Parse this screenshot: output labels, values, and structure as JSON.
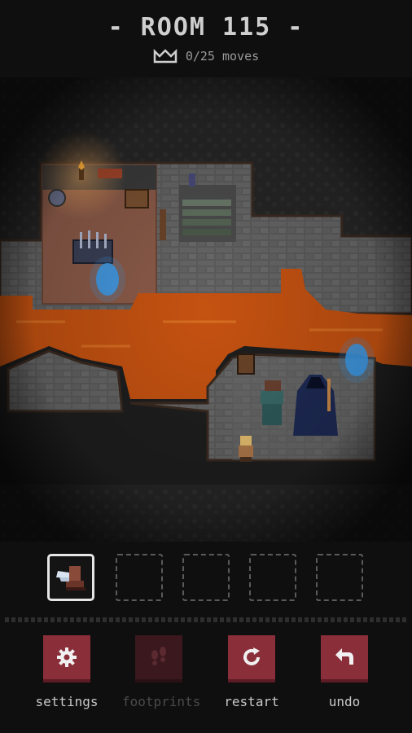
{
  "header": {
    "room_title": "- ROOM 115 -",
    "moves_text": "0/25 moves",
    "crown_icon": "crown-icon"
  },
  "map": {
    "floor_color": "#5d5d5d",
    "lava_color": "#c55211",
    "room_floor_color": "#8a5a48",
    "portal_color": "#3d9be9"
  },
  "inventory": {
    "slots": [
      {
        "item": "winged-boot-icon",
        "filled": true
      },
      {
        "item": "",
        "filled": false
      },
      {
        "item": "",
        "filled": false
      },
      {
        "item": "",
        "filled": false
      },
      {
        "item": "",
        "filled": false
      }
    ]
  },
  "toolbar": {
    "settings_label": "settings",
    "footprints_label": "footprints",
    "restart_label": "restart",
    "undo_label": "undo",
    "accent_color": "#8a2e3a",
    "disabled_color": "#3a181d"
  }
}
